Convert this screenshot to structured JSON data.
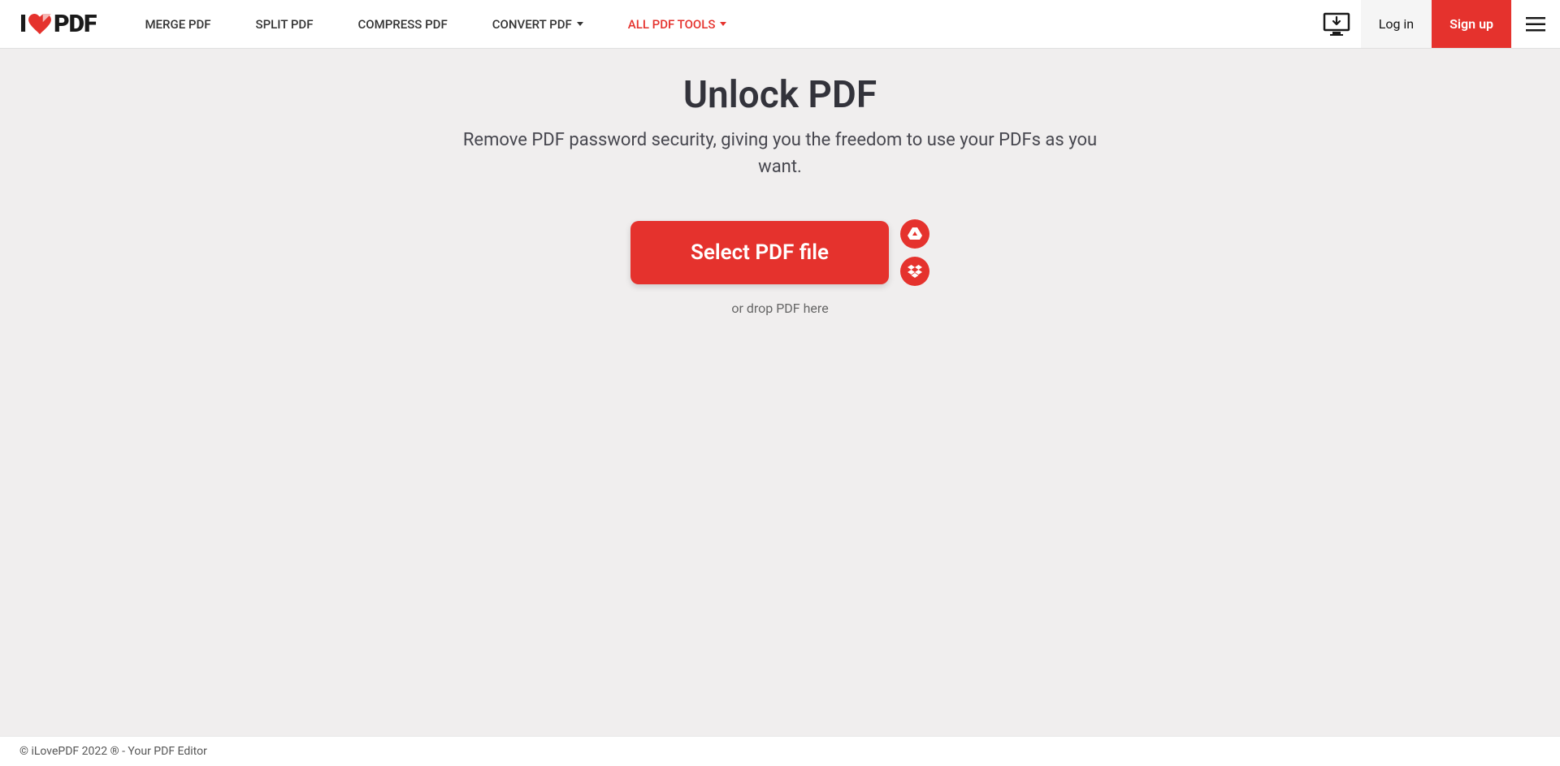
{
  "logo": {
    "prefix": "I",
    "suffix": "PDF"
  },
  "nav": {
    "merge": "MERGE PDF",
    "split": "SPLIT PDF",
    "compress": "COMPRESS PDF",
    "convert": "CONVERT PDF",
    "all_tools": "ALL PDF TOOLS"
  },
  "header_right": {
    "login": "Log in",
    "signup": "Sign up"
  },
  "main": {
    "title": "Unlock PDF",
    "subtitle": "Remove PDF password security, giving you the freedom to use your PDFs as you want.",
    "select_button": "Select PDF file",
    "drop_text": "or drop PDF here"
  },
  "footer": {
    "text": "© iLovePDF 2022 ® - Your PDF Editor"
  },
  "colors": {
    "accent": "#e5322d",
    "bg": "#f0eeee"
  }
}
